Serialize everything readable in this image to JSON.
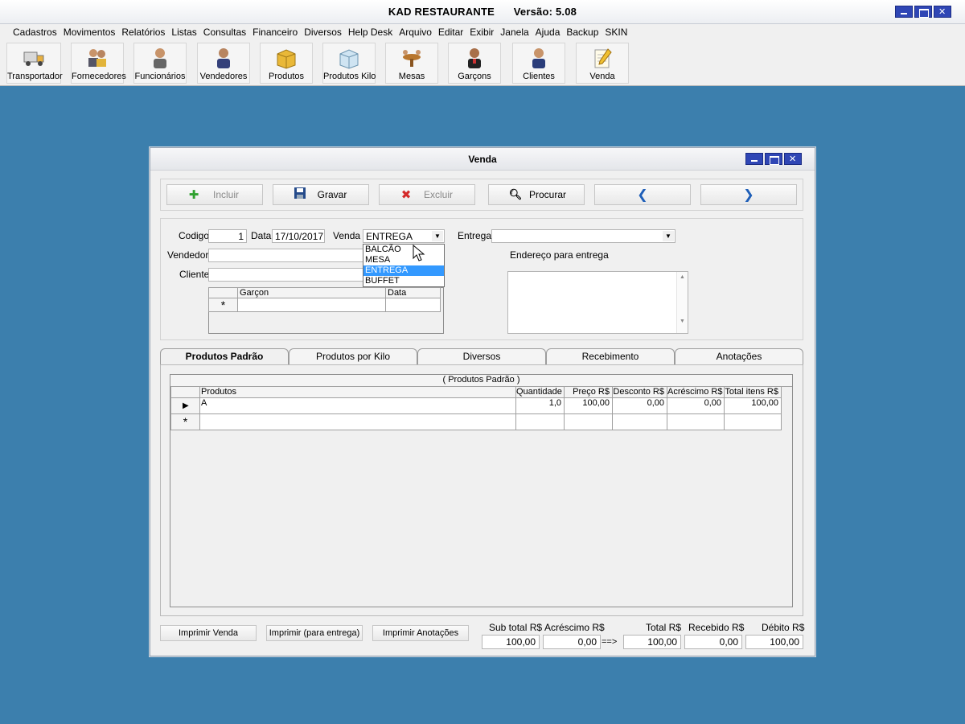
{
  "app": {
    "title": "KAD RESTAURANTE",
    "version": "Versão: 5.08"
  },
  "menu": [
    "Cadastros",
    "Movimentos",
    "Relatórios",
    "Listas",
    "Consultas",
    "Financeiro",
    "Diversos",
    "Help Desk",
    "Arquivo",
    "Editar",
    "Exibir",
    "Janela",
    "Ajuda",
    "Backup",
    "SKIN"
  ],
  "toolbar": {
    "transportador": "Transportador",
    "fornecedores": "Fornecedores",
    "funcionarios": "Funcionários",
    "vendedores": "Vendedores",
    "produtos": "Produtos",
    "produtos_kilo": "Produtos Kilo",
    "mesas": "Mesas",
    "garcons": "Garçons",
    "clientes": "Clientes",
    "venda": "Venda"
  },
  "window": {
    "title": "Venda"
  },
  "actions": {
    "incluir": "Incluir",
    "gravar": "Gravar",
    "excluir": "Excluir",
    "procurar": "Procurar"
  },
  "form": {
    "codigo_label": "Codigo",
    "codigo_value": "1",
    "data_label": "Data",
    "data_value": "17/10/2017",
    "venda_label": "Venda",
    "venda_value": "ENTREGA",
    "venda_options": [
      "BALCÃO",
      "MESA",
      "ENTREGA",
      "BUFFET"
    ],
    "entrega_label": "Entrega",
    "entrega_value": "",
    "vendedor_label": "Vendedor",
    "vendedor_value": "",
    "cliente_label": "Cliente",
    "cliente_value": "",
    "endereco_label": "Endereço para entrega",
    "garcon_grid": {
      "col_garcon": "Garçon",
      "col_data": "Data",
      "new_row_marker": "*"
    }
  },
  "tabs": [
    "Produtos Padrão",
    "Produtos por Kilo",
    "Diversos",
    "Recebimento",
    "Anotações"
  ],
  "products_grid": {
    "caption": "( Produtos Padrão )",
    "columns": [
      "Produtos",
      "Quantidade",
      "Preço R$",
      "Desconto R$",
      "Acréscimo R$",
      "Total itens R$"
    ],
    "rows": [
      {
        "produto": "A",
        "quantidade": "1,0",
        "preco": "100,00",
        "desconto": "0,00",
        "acrescimo": "0,00",
        "total": "100,00"
      }
    ],
    "new_row_marker": "*"
  },
  "footer": {
    "imprimir_venda": "Imprimir Venda",
    "imprimir_entrega": "Imprimir (para entrega)",
    "imprimir_anotacoes": "Imprimir Anotações",
    "subtotal_label": "Sub total R$",
    "subtotal_value": "100,00",
    "acrescimo_label": "Acréscimo R$",
    "acrescimo_value": "0,00",
    "arrow": "==>",
    "total_label": "Total R$",
    "total_value": "100,00",
    "recebido_label": "Recebido R$",
    "recebido_value": "0,00",
    "debito_label": "Débito R$",
    "debito_value": "100,00"
  }
}
